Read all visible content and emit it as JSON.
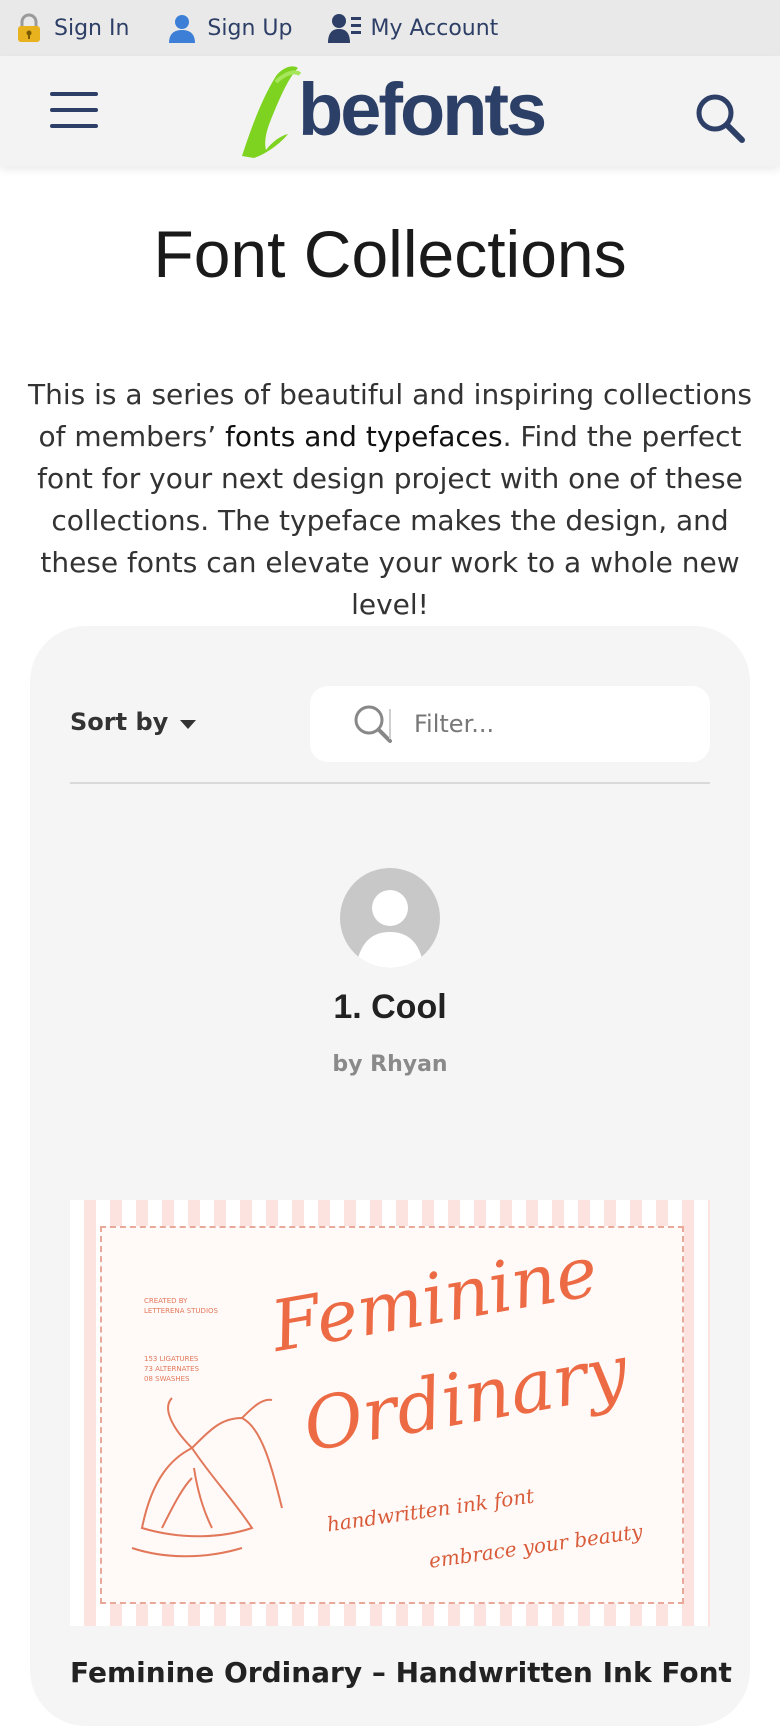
{
  "topbar": {
    "items": [
      {
        "label": "Sign In",
        "icon": "lock-icon"
      },
      {
        "label": "Sign Up",
        "icon": "user-icon"
      },
      {
        "label": "My Account",
        "icon": "account-icon"
      }
    ]
  },
  "header": {
    "logo_text": "befonts",
    "colors": {
      "navy": "#2c3f66",
      "green": "#7ed321"
    }
  },
  "page": {
    "title": "Font Collections",
    "intro_before": "This is a series of beautiful and inspiring collections of members’ ",
    "intro_link": "fonts and typefaces",
    "intro_after": ". Find the perfect font for your next design project with one of these collections. The typeface makes the design, and these fonts can elevate your work to a whole new level!"
  },
  "controls": {
    "sort_label": "Sort by",
    "filter_placeholder": "Filter..."
  },
  "collection": {
    "title": "1. Cool",
    "author": "by Rhyan"
  },
  "font_card": {
    "preview_small_1": "CREATED BY\nLETTERENA STUDIOS",
    "preview_small_2": "153 LIGATURES\n73 ALTERNATES\n08 SWASHES",
    "preview_word_1": "Feminine",
    "preview_word_2": "Ordinary",
    "preview_tag_1": "handwritten ink font",
    "preview_tag_2": "embrace your beauty",
    "name": "Feminine Ordinary – Handwritten Ink Font"
  }
}
